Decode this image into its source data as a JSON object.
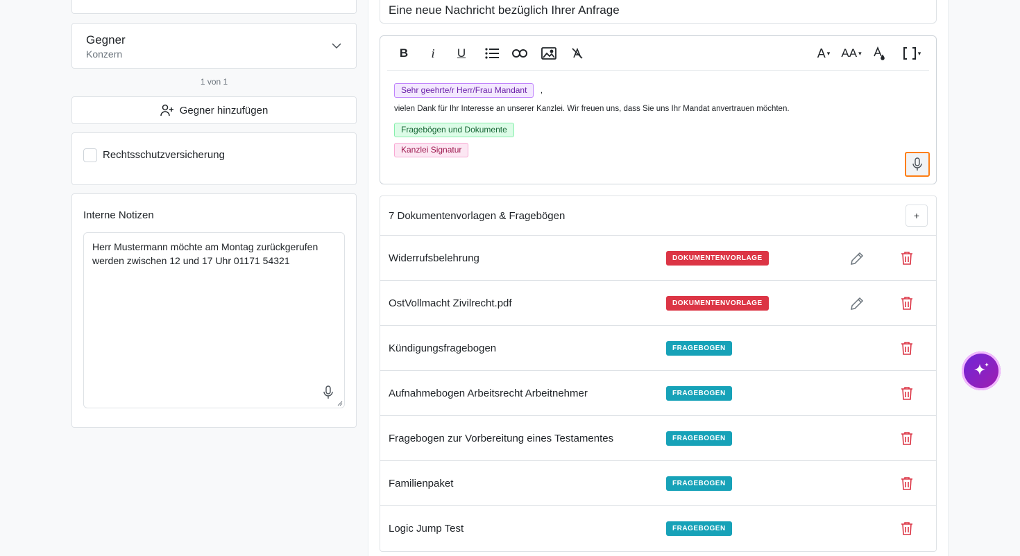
{
  "left": {
    "gegner": {
      "title": "Gegner",
      "subtitle": "Konzern"
    },
    "pager": "1 von 1",
    "add_gegner_label": "Gegner hinzufügen",
    "rechtsschutz_label": "Rechtsschutzversicherung",
    "notes": {
      "label": "Interne Notizen",
      "text": "Herr Mustermann möchte am Montag zurückgerufen werden zwischen 12 und 17 Uhr 01171 54321"
    }
  },
  "message": {
    "subject": "Eine neue Nachricht bezüglich Ihrer Anfrage",
    "toolbar": {
      "bold": "B",
      "italic": "i",
      "underline": "U",
      "font_size": "A",
      "font_case": "AA"
    },
    "greeting_tag": "Sehr geehrte/r Herr/Frau Mandant",
    "greeting_suffix": ",",
    "body_text": "vielen Dank für Ihr Interesse an unserer Kanzlei. Wir freuen uns, dass Sie uns Ihr Mandat anvertrauen möchten.",
    "docs_tag": "Fragebögen und Dokumente",
    "signature_tag": "Kanzlei Signatur"
  },
  "documents": {
    "title": "7 Dokumentenvorlagen & Fragebögen",
    "add_label": "+",
    "items": [
      {
        "name": "Widerrufsbelehrung",
        "type": "DOKUMENTENVORLAGE",
        "editable": true
      },
      {
        "name": "OstVollmacht Zivilrecht.pdf",
        "type": "DOKUMENTENVORLAGE",
        "editable": true
      },
      {
        "name": "Kündigungsfragebogen",
        "type": "FRAGEBOGEN",
        "editable": false
      },
      {
        "name": "Aufnahmebogen Arbeitsrecht Arbeitnehmer",
        "type": "FRAGEBOGEN",
        "editable": false
      },
      {
        "name": "Fragebogen zur Vorbereitung eines Testamentes",
        "type": "FRAGEBOGEN",
        "editable": false
      },
      {
        "name": "Familienpaket",
        "type": "FRAGEBOGEN",
        "editable": false
      },
      {
        "name": "Logic Jump Test",
        "type": "FRAGEBOGEN",
        "editable": false
      }
    ]
  },
  "colors": {
    "doc_badge": "#dc3545",
    "questionnaire_badge": "#17a2b8",
    "delete": "#dc3545",
    "mic_highlight": "#fd7e14",
    "ai_button": "#7e22ce"
  },
  "icons": {
    "chevron": "chevron-down-icon",
    "add_user": "user-plus-icon",
    "mic": "microphone-icon",
    "edit": "pencil-icon",
    "delete": "trash-icon",
    "ai": "sparkles-icon"
  }
}
